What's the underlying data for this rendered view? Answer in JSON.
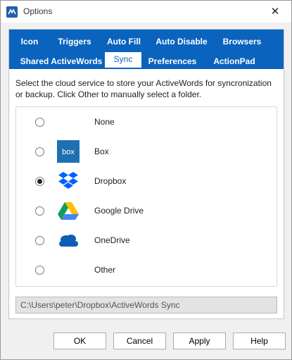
{
  "window": {
    "title": "Options"
  },
  "tabs": {
    "row1": [
      "Icon",
      "Triggers",
      "Auto Fill",
      "Auto Disable",
      "Browsers"
    ],
    "row2": [
      "Shared ActiveWords",
      "Sync",
      "Preferences",
      "ActionPad"
    ],
    "active": "Sync"
  },
  "sync": {
    "description": "Select the cloud service to store your ActiveWords for syncronization or backup. Click Other to manually select a folder.",
    "options": [
      {
        "label": "None",
        "icon": "none",
        "selected": false
      },
      {
        "label": "Box",
        "icon": "box-icon",
        "selected": false
      },
      {
        "label": "Dropbox",
        "icon": "dropbox-icon",
        "selected": true
      },
      {
        "label": "Google Drive",
        "icon": "google-drive-icon",
        "selected": false
      },
      {
        "label": "OneDrive",
        "icon": "onedrive-icon",
        "selected": false
      },
      {
        "label": "Other",
        "icon": "none",
        "selected": false
      }
    ],
    "path": "C:\\Users\\peter\\Dropbox\\ActiveWords Sync"
  },
  "buttons": {
    "ok": "OK",
    "cancel": "Cancel",
    "apply": "Apply",
    "help": "Help"
  },
  "colors": {
    "tab_strip": "#0a63bd",
    "box_brand": "#1f6fb3",
    "dropbox_brand": "#0061fe",
    "onedrive_brand": "#0f5db5"
  }
}
